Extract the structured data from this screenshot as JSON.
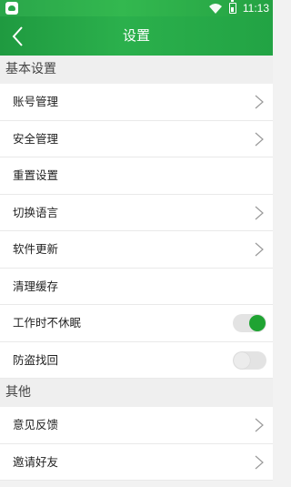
{
  "statusbar": {
    "time": "11:13"
  },
  "header": {
    "title": "设置"
  },
  "sections": [
    {
      "title": "基本设置",
      "items": [
        {
          "label": "账号管理",
          "control": "chevron"
        },
        {
          "label": "安全管理",
          "control": "chevron"
        },
        {
          "label": "重置设置",
          "control": "none"
        },
        {
          "label": "切换语言",
          "control": "chevron"
        },
        {
          "label": "软件更新",
          "control": "chevron"
        },
        {
          "label": "清理缓存",
          "control": "none"
        },
        {
          "label": "工作时不休眠",
          "control": "toggle",
          "on": true
        },
        {
          "label": "防盗找回",
          "control": "toggle",
          "on": false
        }
      ]
    },
    {
      "title": "其他",
      "items": [
        {
          "label": "意见反馈",
          "control": "chevron"
        },
        {
          "label": "邀请好友",
          "control": "chevron"
        }
      ]
    }
  ],
  "colors": {
    "accent": "#22a344",
    "toggle_on": "#1fa332"
  },
  "icons": {
    "status_app": "app-notification-icon",
    "wifi": "wifi-icon",
    "battery": "battery-icon",
    "back": "chevron-left-icon",
    "chevron": "chevron-right-icon"
  }
}
